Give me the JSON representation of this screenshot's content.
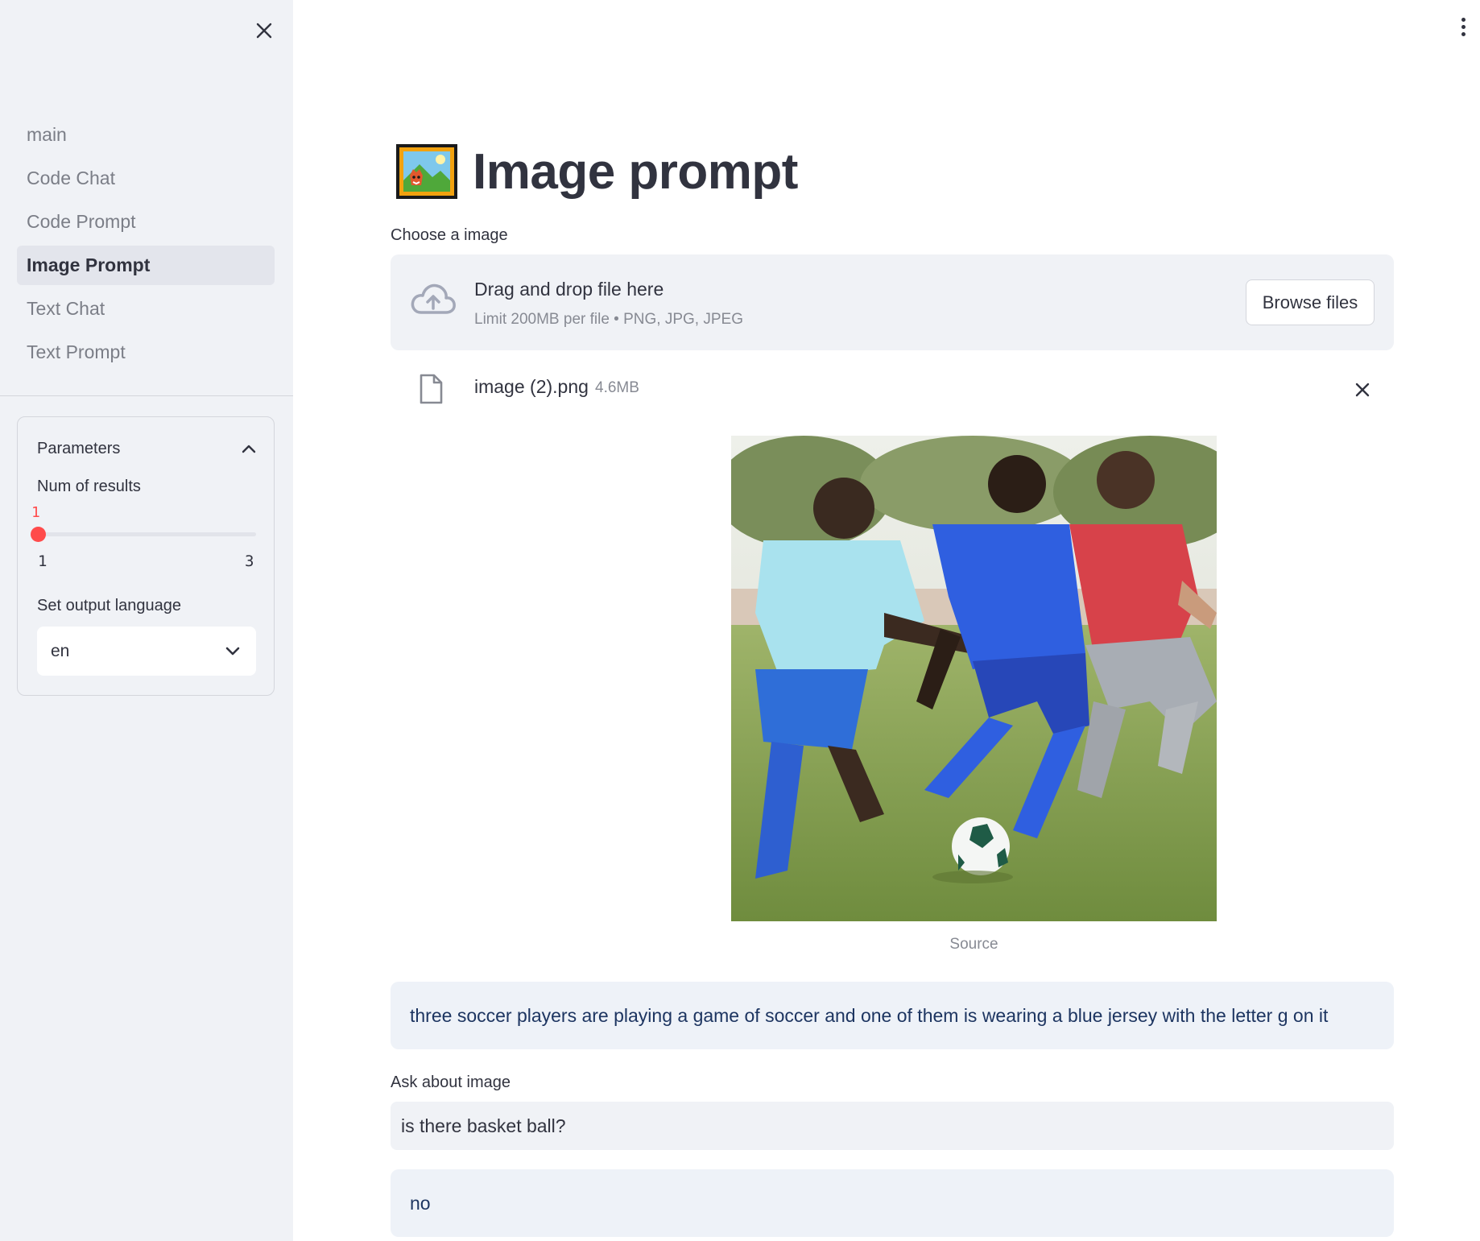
{
  "sidebar": {
    "nav": [
      {
        "label": "main"
      },
      {
        "label": "Code Chat"
      },
      {
        "label": "Code Prompt"
      },
      {
        "label": "Image Prompt",
        "active": true
      },
      {
        "label": "Text Chat"
      },
      {
        "label": "Text Prompt"
      }
    ],
    "parameters": {
      "title": "Parameters",
      "num_results": {
        "label": "Num of results",
        "value": "1",
        "min": "1",
        "max": "3"
      },
      "language": {
        "label": "Set output language",
        "selected": "en"
      }
    }
  },
  "main": {
    "title": "Image prompt",
    "title_icon": "framed-picture-icon",
    "uploader": {
      "label": "Choose a image",
      "drop_title": "Drag and drop file here",
      "drop_hint": "Limit 200MB per file • PNG, JPG, JPEG",
      "browse_label": "Browse files"
    },
    "file": {
      "name": "image (2).png",
      "size": "4.6MB"
    },
    "image_caption": "Source",
    "description": "three soccer players are playing a game of soccer and one of them is wearing a blue jersey with the letter g on it",
    "ask": {
      "label": "Ask about image",
      "value": "is there basket ball?"
    },
    "answer": "no"
  },
  "colors": {
    "accent": "#ff4b4b",
    "sidebar_bg": "#f0f2f6",
    "info_bg": "#eef2f8",
    "info_text": "#1d3561"
  }
}
